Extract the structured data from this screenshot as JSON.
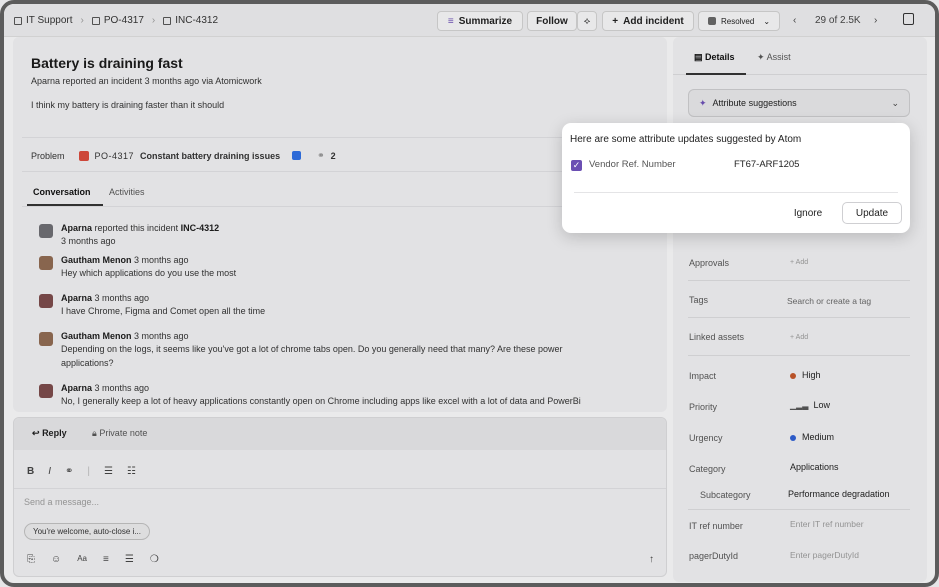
{
  "breadcrumb": {
    "items": [
      "IT Support",
      "PO-4317",
      "INC-4312"
    ]
  },
  "toolbar": {
    "summarize": "Summarize",
    "follow": "Follow",
    "add_incident": "Add incident",
    "resolved": "Resolved",
    "pager": "29 of 2.5K"
  },
  "incident": {
    "title": "Battery is draining fast",
    "reporter": "Aparna",
    "reported_text": "reported an incident",
    "reported_time": "3 months ago",
    "via": "via Atomicwork",
    "description": "I think my battery is draining faster than it should",
    "problem_label": "Problem",
    "problem_id": "PO-4317",
    "problem_title": "Constant battery draining issues",
    "link_count": "2"
  },
  "tabs": {
    "conversation": "Conversation",
    "activities": "Activities"
  },
  "conversation": [
    {
      "author": "Aparna",
      "text": "reported this incident",
      "ref": "INC-4312",
      "time": "3 months ago"
    },
    {
      "author": "Gautham Menon",
      "time": "3 months ago",
      "text": "Hey which applications do you use the most"
    },
    {
      "author": "Aparna",
      "time": "3 months ago",
      "text": "I have Chrome, Figma and Comet open all the time"
    },
    {
      "author": "Gautham Menon",
      "time": "3 months ago",
      "text": "Depending on the logs, it seems like you've got a lot of chrome tabs open. Do you generally need that many? Are these power",
      "text2": "applications?"
    },
    {
      "author": "Aparna",
      "time": "3 months ago",
      "text": "No, I generally keep a lot of heavy applications constantly open on Chrome including apps like excel with a lot of data and PowerBi"
    }
  ],
  "composer": {
    "reply": "Reply",
    "private_note": "Private note",
    "placeholder": "Send a message...",
    "suggestion_chip": "You're welcome, auto-close i..."
  },
  "sidebar": {
    "details": "Details",
    "assist": "Assist",
    "attribute_suggestions": "Attribute suggestions",
    "fields": {
      "approvals": {
        "label": "Approvals",
        "value": "+ Add"
      },
      "tags": {
        "label": "Tags",
        "value": "Search or create a tag"
      },
      "linked_assets": {
        "label": "Linked assets",
        "value": "+ Add"
      },
      "impact": {
        "label": "Impact",
        "value": "High"
      },
      "priority": {
        "label": "Priority",
        "value": "Low"
      },
      "urgency": {
        "label": "Urgency",
        "value": "Medium"
      },
      "category": {
        "label": "Category",
        "value": "Applications"
      },
      "subcategory": {
        "label": "Subcategory",
        "value": "Performance degradation"
      },
      "it_ref": {
        "label": "IT ref number",
        "value": "Enter IT ref number"
      },
      "pagerduty": {
        "label": "pagerDutyId",
        "value": "Enter pagerDutyId"
      }
    }
  },
  "popup": {
    "title": "Here are some attribute updates suggested by Atom",
    "field": "Vendor Ref. Number",
    "value": "FT67-ARF1205",
    "ignore": "Ignore",
    "update": "Update"
  },
  "colors": {
    "accent": "#6b4fb3",
    "impact_high": "#c0562a",
    "urgency_medium": "#2f5fd0",
    "problem_icon": "#d64a3c"
  }
}
